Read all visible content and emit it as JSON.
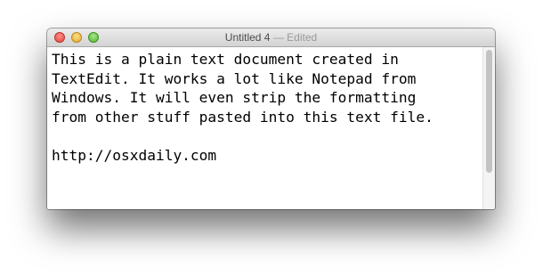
{
  "window": {
    "title": "Untitled 4",
    "separator": "—",
    "status": "Edited"
  },
  "document": {
    "lines": [
      "This is a plain text document created in",
      "TextEdit. It works a lot like Notepad from",
      "Windows. It will even strip the formatting",
      "from other stuff pasted into this text file.",
      "",
      "http://osxdaily.com"
    ]
  },
  "colors": {
    "close": "#e0443e",
    "minimize": "#e0a62a",
    "zoom": "#55b631"
  },
  "icons": [
    "close-button",
    "minimize-button",
    "zoom-button"
  ]
}
